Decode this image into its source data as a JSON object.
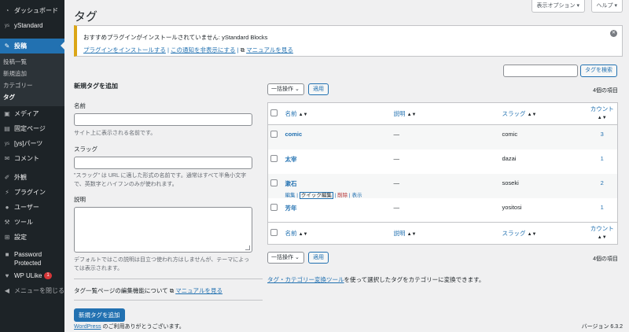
{
  "sidebar": {
    "items": [
      {
        "label": "ダッシュボード",
        "icon": "dashboard-icon"
      },
      {
        "label": "yStandard",
        "icon": "ystandard-icon"
      },
      {
        "label": "投稿",
        "icon": "pin-icon"
      },
      {
        "label": "メディア",
        "icon": "media-icon"
      },
      {
        "label": "固定ページ",
        "icon": "page-icon"
      },
      {
        "label": "[ys]パーツ",
        "icon": "ys-icon"
      },
      {
        "label": "コメント",
        "icon": "comment-icon"
      },
      {
        "label": "外観",
        "icon": "brush-icon"
      },
      {
        "label": "プラグイン",
        "icon": "plugin-icon"
      },
      {
        "label": "ユーザー",
        "icon": "user-icon"
      },
      {
        "label": "ツール",
        "icon": "wrench-icon"
      },
      {
        "label": "設定",
        "icon": "settings-icon"
      },
      {
        "label": "Password Protected",
        "icon": "lock-icon"
      },
      {
        "label": "WP ULike",
        "icon": "heart-icon",
        "badge": "1"
      },
      {
        "label": "メニューを閉じる",
        "icon": "collapse-icon"
      }
    ],
    "submenu": [
      "投稿一覧",
      "新規追加",
      "カテゴリー",
      "タグ"
    ]
  },
  "header": {
    "title": "タグ",
    "screen_options": "表示オプション ▾",
    "help": "ヘルプ ▾"
  },
  "notice": {
    "title": "おすすめプラグインがインストールされていません: yStandard Blocks",
    "link_install": "プラグインをインストールする",
    "sep1": " | ",
    "link_hide": "この通知を非表示にする",
    "sep2": " | ",
    "link_manual": "マニュアルを見る"
  },
  "form": {
    "heading": "新規タグを追加",
    "name_label": "名前",
    "name_help": "サイト上に表示される名前です。",
    "slug_label": "スラッグ",
    "slug_help": "\"スラッグ\" は URL に適した形式の名前です。通常はすべて半角小文字で、英数字とハイフンのみが使われます。",
    "desc_label": "説明",
    "desc_help": "デフォルトではこの説明は目立つ使われ方はしませんが、テーマによっては表示されます。",
    "manual_text": "タグ一覧ページの編集機能について",
    "manual_link": "マニュアルを見る",
    "submit": "新規タグを追加"
  },
  "list": {
    "search_button": "タグを検索",
    "bulk_action": "一括操作",
    "apply": "適用",
    "count": "4個の項目",
    "columns": {
      "name": "名前",
      "description": "説明",
      "slug": "スラッグ",
      "count": "カウント"
    },
    "rows": [
      {
        "name": "comic",
        "description": "—",
        "slug": "comic",
        "count": "3"
      },
      {
        "name": "太宰",
        "description": "—",
        "slug": "dazai",
        "count": "1"
      },
      {
        "name": "漱石",
        "description": "—",
        "slug": "soseki",
        "count": "2",
        "actions": {
          "edit": "編集",
          "quick": "クイック編集",
          "delete": "削除",
          "view": "表示"
        }
      },
      {
        "name": "芳年",
        "description": "—",
        "slug": "yositosi",
        "count": "1"
      }
    ],
    "convert_link": "タグ・カテゴリー変換ツール",
    "convert_text": "を使って選択したタグをカテゴリーに変換できます。"
  },
  "footer": {
    "wp_link": "WordPress",
    "thanks": " のご利用ありがとうございます。",
    "version": "バージョン 6.3.2"
  },
  "colors": {
    "accent": "#2271b1",
    "sidebar": "#1d2327",
    "notice_border": "#dba617"
  }
}
